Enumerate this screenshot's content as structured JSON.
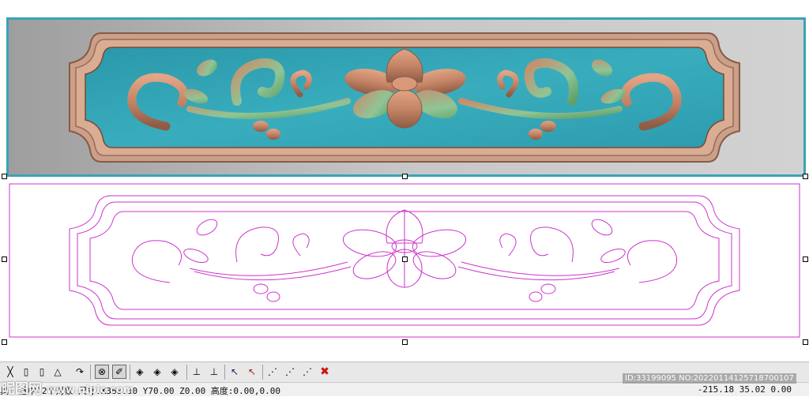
{
  "colors": {
    "selection_frame": "#3aa3b5",
    "relief_background": "#b9b9b9",
    "relief_panel": "#36a8b8",
    "relief_carving": "#c98c6c",
    "relief_leaf_green": "#7fbf8a",
    "vector_line": "#cc33cc",
    "toolbar_bg": "#e8e8e8",
    "status_bg": "#f0f0f0"
  },
  "canvas": {
    "relief_preview": {
      "description_icon": "relief-carving-preview"
    },
    "vector_drawing": {
      "description_icon": "vector-outline-drawing"
    }
  },
  "toolbar": {
    "buttons": [
      {
        "icon": "line-tool-icon",
        "glyph": "╳"
      },
      {
        "icon": "shape-tool-icon",
        "glyph": "▯"
      },
      {
        "icon": "shape-tool-icon",
        "glyph": "▯"
      },
      {
        "icon": "move-tool-icon",
        "glyph": "△"
      },
      {
        "icon": "arc-tool-icon",
        "glyph": "↷"
      },
      {
        "icon": "snap-center-icon",
        "glyph": "⊗",
        "pressed": true
      },
      {
        "icon": "pen-tool-icon",
        "glyph": "✐",
        "pressed": true
      },
      {
        "icon": "node-edit-icon",
        "glyph": "◈"
      },
      {
        "icon": "node-edit-icon",
        "glyph": "◈"
      },
      {
        "icon": "node-edit-icon",
        "glyph": "◈"
      },
      {
        "icon": "relief-tool-icon",
        "glyph": "⊥"
      },
      {
        "icon": "relief-tool-icon",
        "glyph": "⊥"
      },
      {
        "icon": "select-arrow-icon",
        "glyph": "↖"
      },
      {
        "icon": "deselect-arrow-icon",
        "glyph": "↖"
      },
      {
        "icon": "path-tool-icon",
        "glyph": "⋰"
      },
      {
        "icon": "path-tool-icon",
        "glyph": "⋰"
      },
      {
        "icon": "path-tool-icon",
        "glyph": "⋰"
      },
      {
        "icon": "delete-icon",
        "glyph": "✖"
      }
    ]
  },
  "status": {
    "left_text": "具: 选中52个对象 尺寸:X360.00 Y70.00 Z0.00 高度:0.00,0.00",
    "right_text": "-215.18 35.02 0.00"
  },
  "watermark": {
    "left_text": "昵图网",
    "left_url": "www.nipic.com",
    "right_text": "ID:33199095 NO:20220114125718700107"
  }
}
